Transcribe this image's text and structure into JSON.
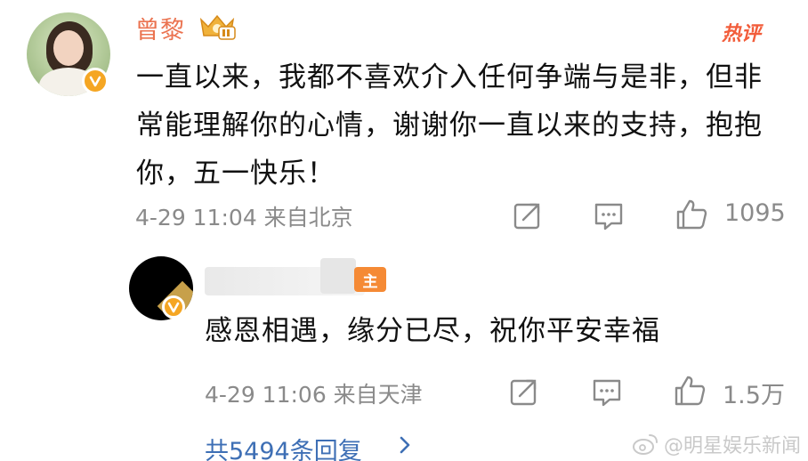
{
  "main_comment": {
    "username": "曾黎",
    "hot_tag": "热评",
    "text": "一直以来，我都不喜欢介入任何争端与是非，但非常能理解你的心情，谢谢你一直以来的支持，抱抱你，五一快乐！",
    "timestamp": "4-29 11:04 来自北京",
    "like_count": "1095"
  },
  "reply": {
    "badge": "主",
    "text": "感恩相遇，缘分已尽，祝你平安幸福",
    "timestamp": "4-29 11:06 来自天津",
    "like_count": "1.5万"
  },
  "more_replies": "共5494条回复",
  "watermark": "@明星娱乐新闻",
  "colors": {
    "username": "#eb7350",
    "hot": "#f25d3b",
    "link": "#3e6fb5",
    "meta": "#8a8a8a"
  }
}
